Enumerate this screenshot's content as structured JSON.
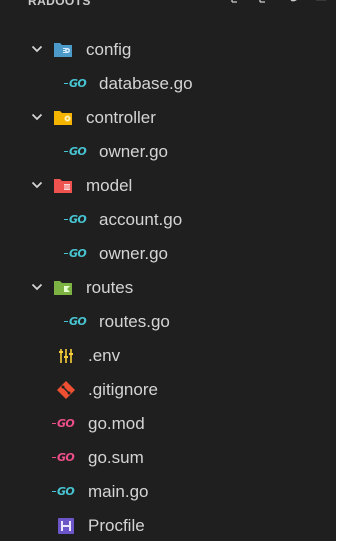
{
  "explorer": {
    "section_title": "RADOOTS",
    "actions": [
      "new-file-icon",
      "new-folder-icon",
      "refresh-icon",
      "collapse-icon"
    ]
  },
  "tree": {
    "config": {
      "label": "config",
      "children": [
        {
          "label": "database.go",
          "badge": "GO"
        }
      ]
    },
    "controller": {
      "label": "controller",
      "children": [
        {
          "label": "owner.go",
          "badge": "GO"
        }
      ]
    },
    "model": {
      "label": "model",
      "children": [
        {
          "label": "account.go",
          "badge": "GO"
        },
        {
          "label": "owner.go",
          "badge": "GO"
        }
      ]
    },
    "routes": {
      "label": "routes",
      "children": [
        {
          "label": "routes.go",
          "badge": "GO"
        }
      ]
    },
    "root_files": [
      {
        "label": ".env",
        "icon": "env-sliders-icon"
      },
      {
        "label": ".gitignore",
        "icon": "git-icon"
      },
      {
        "label": "go.mod",
        "badge": "GO"
      },
      {
        "label": "go.sum",
        "badge": "GO"
      },
      {
        "label": "main.go",
        "badge": "GO"
      },
      {
        "label": "Procfile",
        "badge": "H"
      }
    ]
  },
  "colors": {
    "background": "#1f1f1f",
    "text": "#d4d4d4",
    "folder_config": "#4b9ac9",
    "folder_controller": "#f4b400",
    "folder_model": "#ef5350",
    "folder_routes": "#7cb342",
    "go_cyan": "#48c5d3",
    "go_pink": "#ee4f8a",
    "git": "#f05032",
    "env": "#f8cf3b",
    "procfile": "#6b55c8"
  }
}
